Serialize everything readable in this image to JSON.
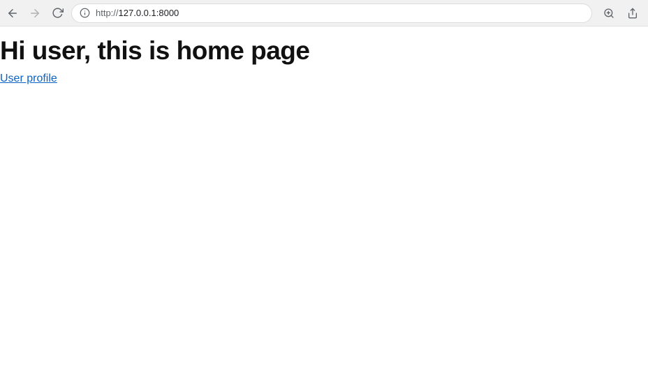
{
  "toolbar": {
    "url_protocol": "http://",
    "url_host": "127.0.0.1:8000"
  },
  "page": {
    "heading": "Hi user, this is home page",
    "link_label": "User profile"
  }
}
